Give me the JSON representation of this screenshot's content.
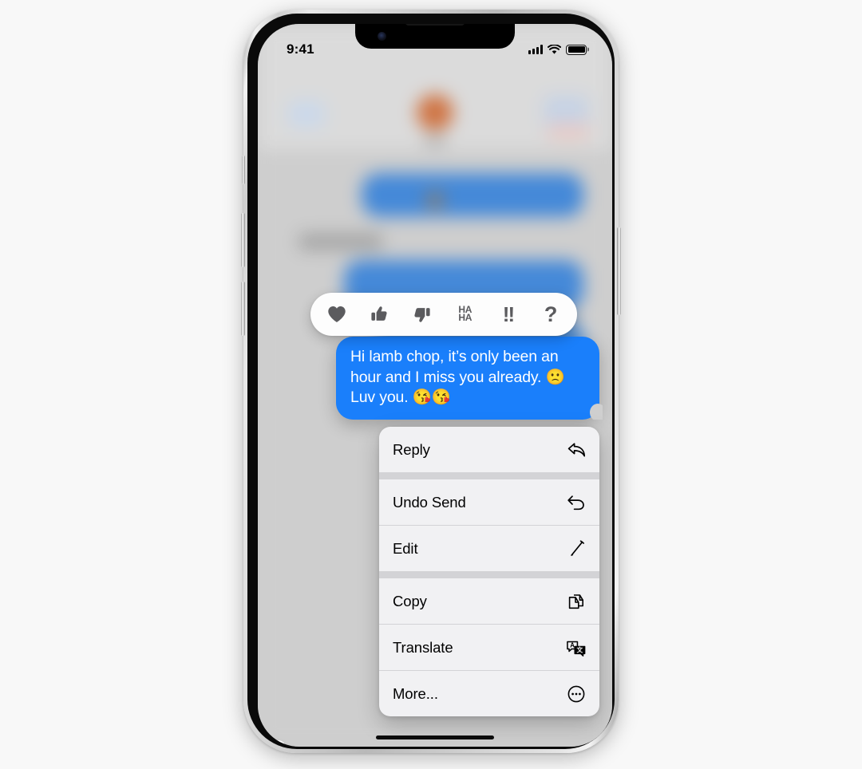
{
  "status_bar": {
    "time": "9:41",
    "signal_icon": "cellular-signal-icon",
    "wifi_icon": "wifi-icon",
    "battery_icon": "battery-full-icon",
    "battery_level": 100
  },
  "conversation": {
    "app": "Messages",
    "focused_message": {
      "sender": "me",
      "text": "Hi lamb chop, it’s only been an hour and I miss you already. 🙁 Luv you. 😘😘",
      "line1": "Hi lamb chop, it’s only been an",
      "line2": "hour and I miss you already. 🙁",
      "line3": "Luv you. 😘😘",
      "bubble_color": "#1a7ffb",
      "text_color": "#ffffff"
    }
  },
  "tapback_bar": {
    "items": [
      {
        "id": "heart",
        "label": "Love",
        "icon": "heart-icon"
      },
      {
        "id": "thumbsup",
        "label": "Like",
        "icon": "thumbs-up-icon"
      },
      {
        "id": "thumbsdown",
        "label": "Dislike",
        "icon": "thumbs-down-icon"
      },
      {
        "id": "haha",
        "label": "HA\nHA",
        "icon": "haha-icon",
        "line1": "HA",
        "line2": "HA"
      },
      {
        "id": "exclaim",
        "label": "!!",
        "icon": "double-exclamation-icon"
      },
      {
        "id": "question",
        "label": "?",
        "icon": "question-mark-icon"
      }
    ]
  },
  "context_menu": {
    "groups": [
      {
        "items": [
          {
            "label": "Reply",
            "icon": "reply-arrow-icon"
          }
        ]
      },
      {
        "items": [
          {
            "label": "Undo Send",
            "icon": "undo-arrow-icon"
          },
          {
            "label": "Edit",
            "icon": "pencil-icon"
          }
        ]
      },
      {
        "items": [
          {
            "label": "Copy",
            "icon": "copy-documents-icon"
          },
          {
            "label": "Translate",
            "icon": "translate-icon"
          },
          {
            "label": "More...",
            "icon": "ellipsis-circle-icon"
          }
        ]
      }
    ]
  },
  "device": {
    "model": "iPhone",
    "buttons": [
      "mute-switch",
      "volume-up",
      "volume-down",
      "side-button"
    ],
    "home_indicator": true
  },
  "colors": {
    "imessage_blue": "#1a7ffb",
    "menu_background": "#f1f1f3",
    "divider": "#d3d3d6",
    "tapback_background": "#fdfdfd",
    "avatar_orange": "#d4652a",
    "page_background": "#f8f8f8"
  }
}
